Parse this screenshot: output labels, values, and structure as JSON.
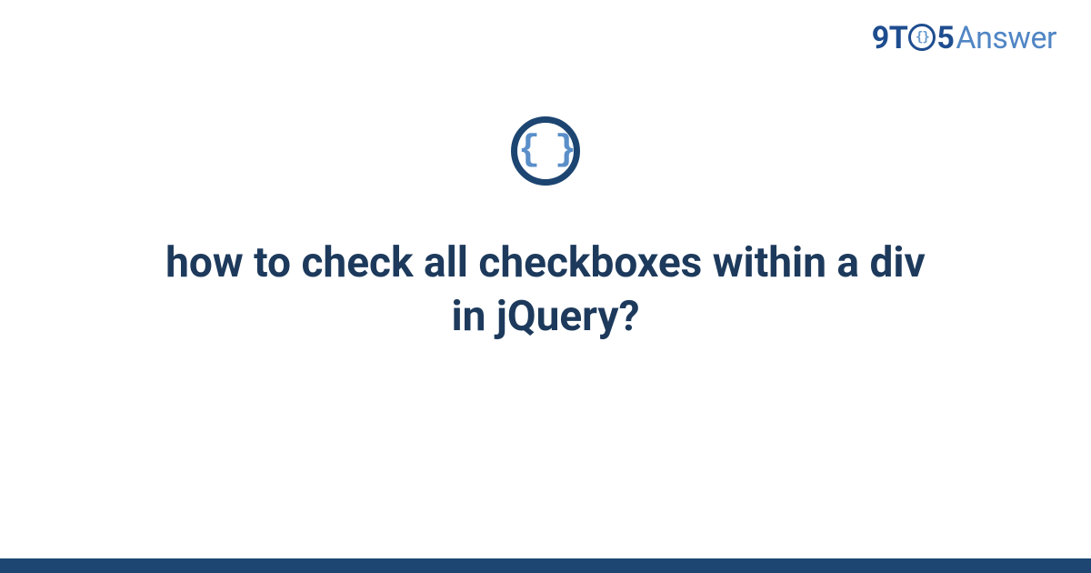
{
  "brand": {
    "part1": "9T",
    "icon_inner": "{}",
    "part2": "5",
    "part3": "Answer"
  },
  "icon": {
    "braces": "{ }"
  },
  "question": {
    "title": "how to check all checkboxes within a div in jQuery?"
  },
  "colors": {
    "brand_dark": "#1e4d8f",
    "brand_light": "#5186c4",
    "icon_ring": "#1d4571",
    "icon_braces": "#5a8fc9",
    "title_text": "#1d3a5c",
    "bottom_bar": "#1d4673"
  }
}
